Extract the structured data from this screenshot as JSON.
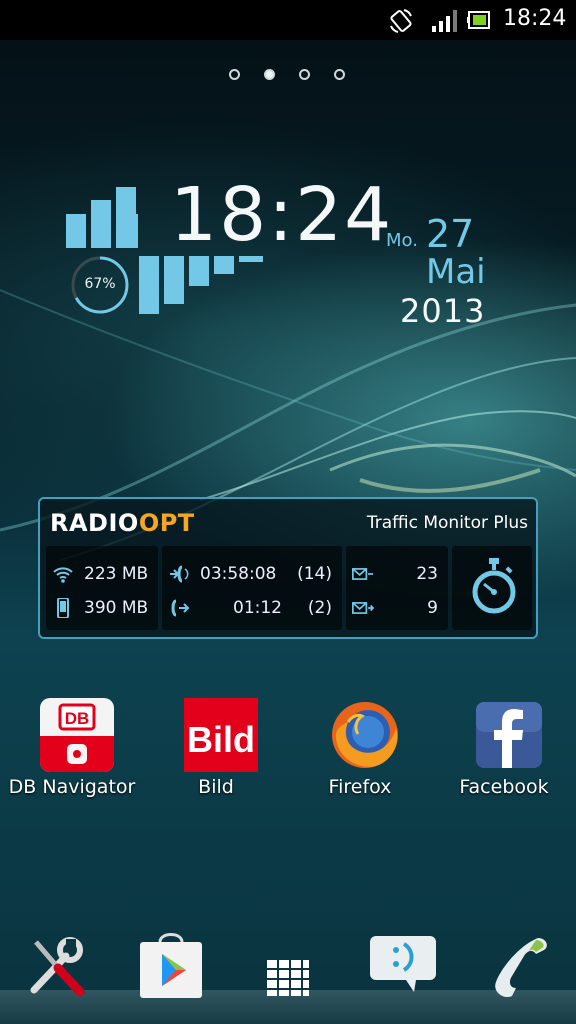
{
  "status_bar": {
    "time": "18:24",
    "icons": [
      "auto-rotate-icon",
      "signal-icon",
      "battery-icon"
    ]
  },
  "home_pages": {
    "count": 4,
    "active_index": 1
  },
  "clock_widget": {
    "time": "18:24",
    "battery_percent": "67%",
    "battery_level": 0.67,
    "weekday": "Mo.",
    "day": "27",
    "month": "Mai",
    "year": "2013",
    "accent_color": "#73c8e8"
  },
  "traffic_widget": {
    "brand_prefix": "RADIO",
    "brand_suffix": "OPT",
    "title": "Traffic Monitor Plus",
    "data": {
      "wifi": "223 MB",
      "mobile": "390 MB"
    },
    "calls": {
      "incoming_duration": "03:58:08",
      "incoming_count": "(14)",
      "outgoing_duration": "01:12",
      "outgoing_count": "(2)"
    },
    "sms": {
      "received": "23",
      "sent": "9"
    },
    "accent_color": "#f5a623"
  },
  "apps": [
    {
      "label": "DB Navigator",
      "icon": "db-navigator-icon"
    },
    {
      "label": "Bild",
      "icon": "bild-icon"
    },
    {
      "label": "Firefox",
      "icon": "firefox-icon"
    },
    {
      "label": "Facebook",
      "icon": "facebook-icon"
    }
  ],
  "dock": [
    "settings-tools-icon",
    "play-store-icon",
    "app-drawer-icon",
    "messaging-icon",
    "phone-icon"
  ]
}
